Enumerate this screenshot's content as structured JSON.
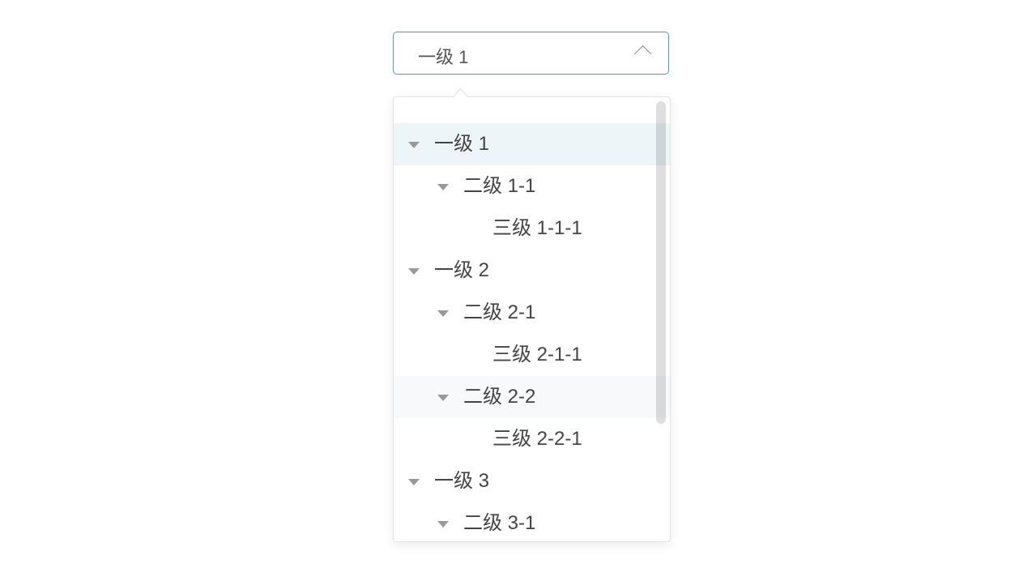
{
  "select": {
    "value": "一级 1",
    "icon": "chevron-up-icon"
  },
  "tree": [
    {
      "label": "一级 1",
      "level": 0,
      "expandable": true,
      "state": "selected"
    },
    {
      "label": "二级 1-1",
      "level": 1,
      "expandable": true,
      "state": ""
    },
    {
      "label": "三级 1-1-1",
      "level": 2,
      "expandable": false,
      "state": ""
    },
    {
      "label": "一级 2",
      "level": 0,
      "expandable": true,
      "state": ""
    },
    {
      "label": "二级 2-1",
      "level": 1,
      "expandable": true,
      "state": ""
    },
    {
      "label": "三级 2-1-1",
      "level": 2,
      "expandable": false,
      "state": ""
    },
    {
      "label": "二级 2-2",
      "level": 1,
      "expandable": true,
      "state": "hover"
    },
    {
      "label": "三级 2-2-1",
      "level": 2,
      "expandable": false,
      "state": ""
    },
    {
      "label": "一级 3",
      "level": 0,
      "expandable": true,
      "state": ""
    },
    {
      "label": "二级 3-1",
      "level": 1,
      "expandable": true,
      "state": ""
    }
  ],
  "colors": {
    "accent": "#4a9ebd",
    "selected_bg": "#edf5f8",
    "hover_bg": "#f7f9fb"
  }
}
